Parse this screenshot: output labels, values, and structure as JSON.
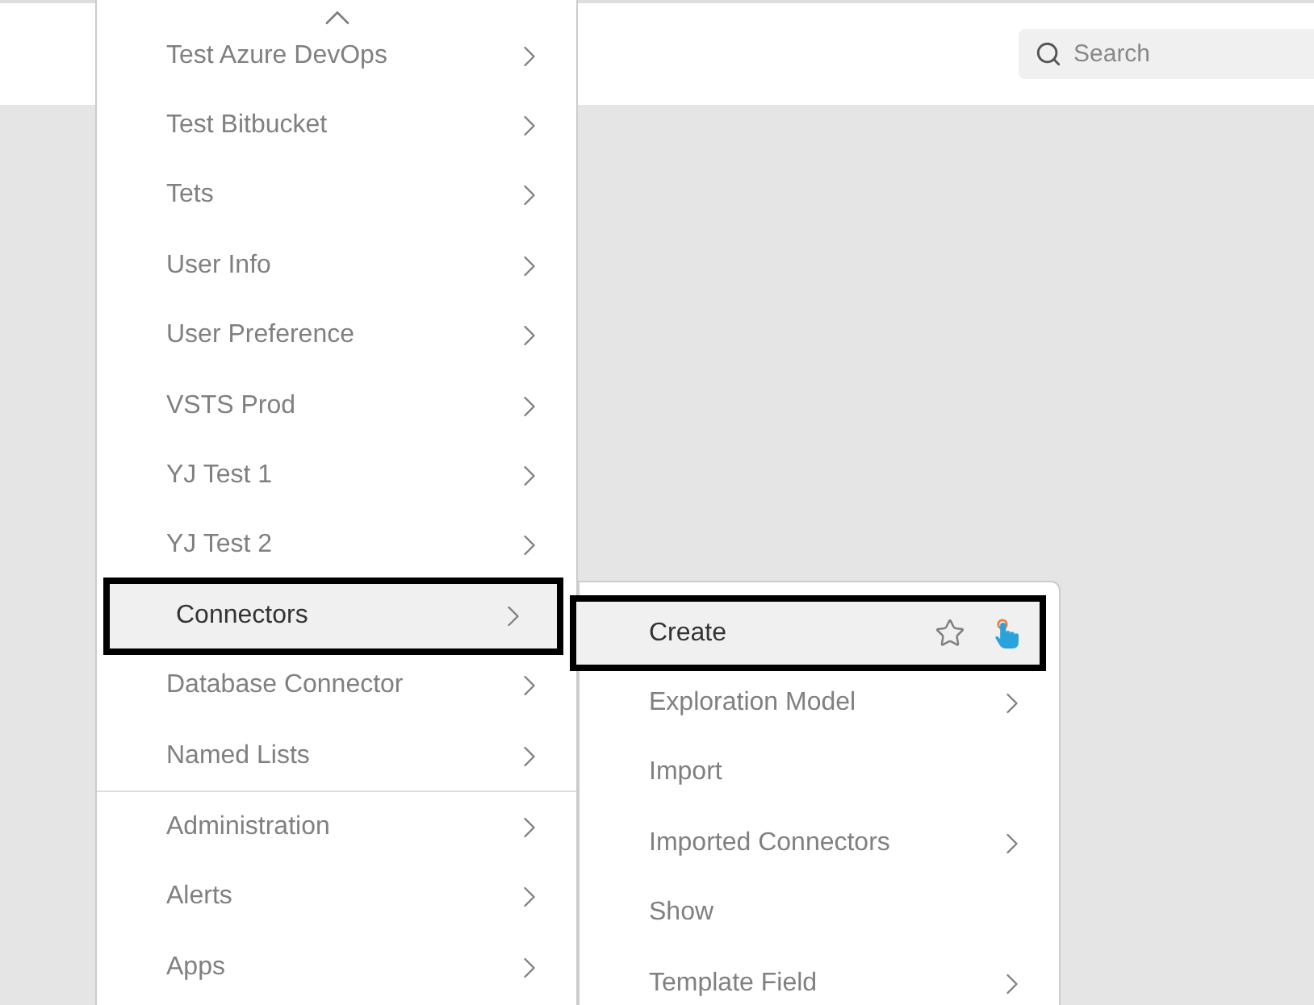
{
  "search": {
    "placeholder": "Search"
  },
  "menu": {
    "groups": [
      [
        {
          "label": "Test Azure DevOps",
          "selected": false
        },
        {
          "label": "Test Bitbucket",
          "selected": false
        },
        {
          "label": "Tets",
          "selected": false
        },
        {
          "label": "User Info",
          "selected": false
        },
        {
          "label": "User Preference",
          "selected": false
        },
        {
          "label": "VSTS Prod",
          "selected": false
        },
        {
          "label": "YJ Test 1",
          "selected": false
        },
        {
          "label": "YJ Test 2",
          "selected": false
        },
        {
          "label": "Connectors",
          "selected": true
        },
        {
          "label": "Database Connector",
          "selected": false
        },
        {
          "label": "Named Lists",
          "selected": false
        }
      ],
      [
        {
          "label": "Administration",
          "selected": false
        },
        {
          "label": "Alerts",
          "selected": false
        },
        {
          "label": "Apps",
          "selected": false
        }
      ]
    ]
  },
  "submenu": {
    "items": [
      {
        "label": "Create",
        "kind": "action",
        "selected": true
      },
      {
        "label": "Exploration Model",
        "kind": "folder",
        "selected": false
      },
      {
        "label": "Import",
        "kind": "plain",
        "selected": false
      },
      {
        "label": "Imported Connectors",
        "kind": "folder",
        "selected": false
      },
      {
        "label": "Show",
        "kind": "plain",
        "selected": false
      },
      {
        "label": "Template Field",
        "kind": "folder",
        "selected": false
      }
    ]
  }
}
